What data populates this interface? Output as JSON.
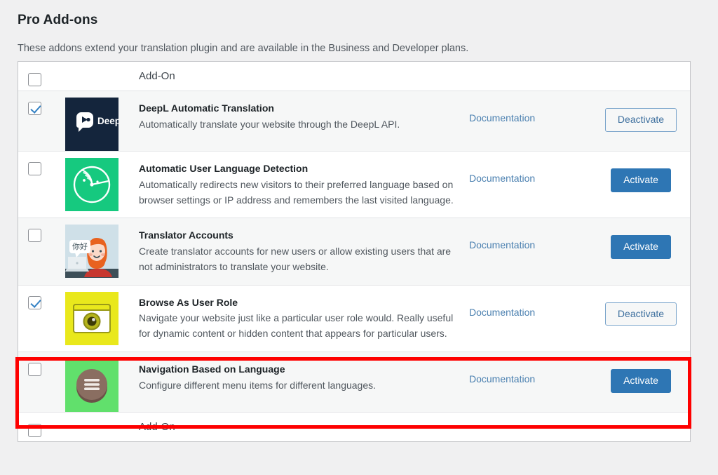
{
  "page": {
    "title": "Pro Add-ons",
    "description": "These addons extend your translation plugin and are available in the Business and Developer plans."
  },
  "table": {
    "header_label": "Add-On",
    "footer_label": "Add-On",
    "rows": [
      {
        "checked": true,
        "icon": "deepl-logo-icon",
        "title": "DeepL Automatic Translation",
        "description": "Automatically translate your website through the DeepL API.",
        "doc_label": "Documentation",
        "action_label": "Deactivate",
        "action_style": "secondary"
      },
      {
        "checked": false,
        "icon": "radar-detection-icon",
        "title": "Automatic User Language Detection",
        "description": "Automatically redirects new visitors to their preferred language based on browser settings or IP address and remembers the last visited language.",
        "doc_label": "Documentation",
        "action_label": "Activate",
        "action_style": "primary"
      },
      {
        "checked": false,
        "icon": "translator-person-icon",
        "title": "Translator Accounts",
        "description": "Create translator accounts for new users or allow existing users that are not administrators to translate your website.",
        "doc_label": "Documentation",
        "action_label": "Activate",
        "action_style": "primary"
      },
      {
        "checked": true,
        "icon": "browser-eye-icon",
        "title": "Browse As User Role",
        "description": "Navigate your website just like a particular user role would. Really useful for dynamic content or hidden content that appears for particular users.",
        "doc_label": "Documentation",
        "action_label": "Deactivate",
        "action_style": "secondary"
      },
      {
        "checked": false,
        "icon": "hamburger-menu-icon",
        "title": "Navigation Based on Language",
        "description": "Configure different menu items for different languages.",
        "doc_label": "Documentation",
        "action_label": "Activate",
        "action_style": "primary"
      }
    ]
  },
  "annotation": {
    "highlight_color": "#fe0000",
    "highlighted_row_title": "Navigation Based on Language"
  },
  "colors": {
    "primary_button": "#2e76b4",
    "link": "#4b80b0",
    "page_background": "#f0f0f1",
    "row_alt_background": "#f6f7f7",
    "title_text": "#1d2327",
    "body_text": "#50575e"
  },
  "icon_text": {
    "deepl_wordmark": "DeepL",
    "translator_bubble": "你好"
  }
}
